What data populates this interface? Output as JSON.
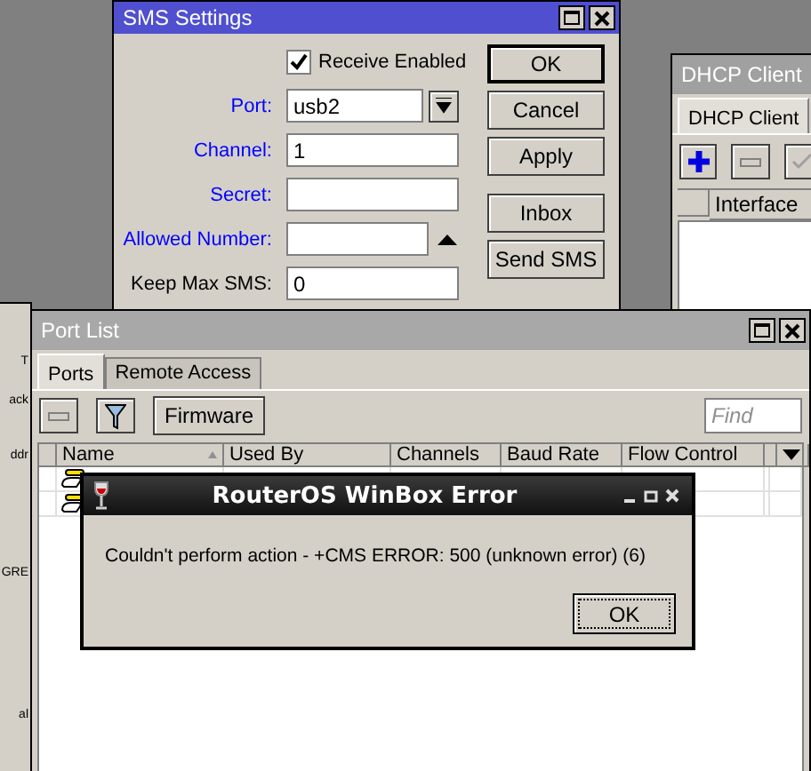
{
  "left_window": {
    "texts": [
      "T",
      "ack",
      "ddr",
      "GRE",
      "al"
    ]
  },
  "sms_settings": {
    "title": "SMS Settings",
    "receive_enabled": {
      "label": "Receive Enabled",
      "checked": true
    },
    "fields": [
      {
        "kind": "dropdown",
        "label": "Port:",
        "value": "usb2",
        "highlighted": true
      },
      {
        "kind": "text",
        "label": "Channel:",
        "value": "1",
        "highlighted": true
      },
      {
        "kind": "text",
        "label": "Secret:",
        "highlighted": true
      },
      {
        "kind": "expandable",
        "label": "Allowed Number:",
        "highlighted": true
      },
      {
        "kind": "text",
        "label": "Keep Max SMS:",
        "value": "0",
        "highlighted": false
      }
    ],
    "button_groups": [
      [
        {
          "label": "OK",
          "default": true
        },
        {
          "label": "Cancel",
          "default": false
        },
        {
          "label": "Apply",
          "default": false
        }
      ],
      [
        {
          "label": "Inbox",
          "default": false
        },
        {
          "label": "Send SMS",
          "default": false
        }
      ]
    ]
  },
  "dhcp_client": {
    "title": "DHCP Client",
    "tabs": [
      {
        "label": "DHCP Client",
        "selected": true
      }
    ],
    "columns": [
      "Interface"
    ]
  },
  "port_list": {
    "title": "Port List",
    "tabs": [
      {
        "label": "Ports",
        "selected": true
      },
      {
        "label": "Remote Access",
        "selected": false
      }
    ],
    "firmware_button": "Firmware",
    "find": {
      "placeholder": "Find"
    },
    "columns": [
      {
        "label": "Name",
        "sorted": true
      },
      {
        "label": "Used By",
        "sorted": false
      },
      {
        "label": "Channels",
        "sorted": false
      },
      {
        "label": "Baud Rate",
        "sorted": false
      },
      {
        "label": "Flow Control",
        "sorted": false
      }
    ],
    "rows": [
      {
        "kind": "port"
      },
      {
        "kind": "port"
      }
    ]
  },
  "error_dialog": {
    "title": "RouterOS WinBox Error",
    "message": "Couldn't perform action - +CMS ERROR: 500 (unknown error) (6)",
    "button": "OK"
  }
}
